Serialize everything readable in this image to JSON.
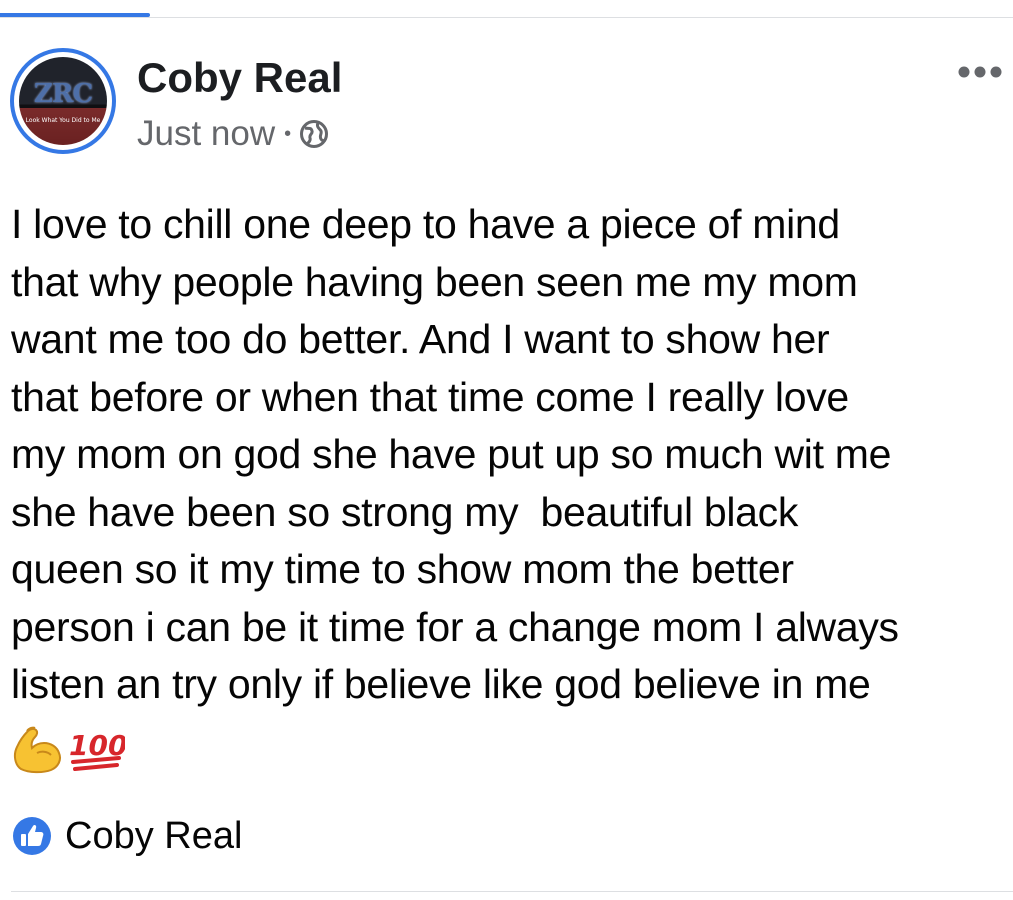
{
  "post": {
    "author": "Coby Real",
    "timestamp": "Just now",
    "separator": "•",
    "privacy_icon": "globe-icon",
    "more_icon": "more-options-icon",
    "avatar": {
      "logo_text": "ZRC",
      "caption": "Look What You Did to Me"
    },
    "body_text": "I love to chill one deep to have a piece of mind\nthat why people having been seen me my mom\nwant me too do better. And I want to show her\nthat before or when that time come I really love\nmy mom on god she have put up so much wit me\nshe have been so strong my  beautiful black\nqueen so it my time to show mom the better\nperson i can be it time for a change mom I always\nlisten an try only if believe like god believe in me",
    "emojis": [
      "flexed-biceps-icon",
      "hundred-points-icon"
    ],
    "reactions": {
      "icon": "like-icon",
      "names": "Coby Real"
    }
  },
  "colors": {
    "accent_blue": "#3578e5",
    "secondary_text": "#65676b",
    "primary_text": "#050505",
    "divider": "#dddfe2"
  }
}
